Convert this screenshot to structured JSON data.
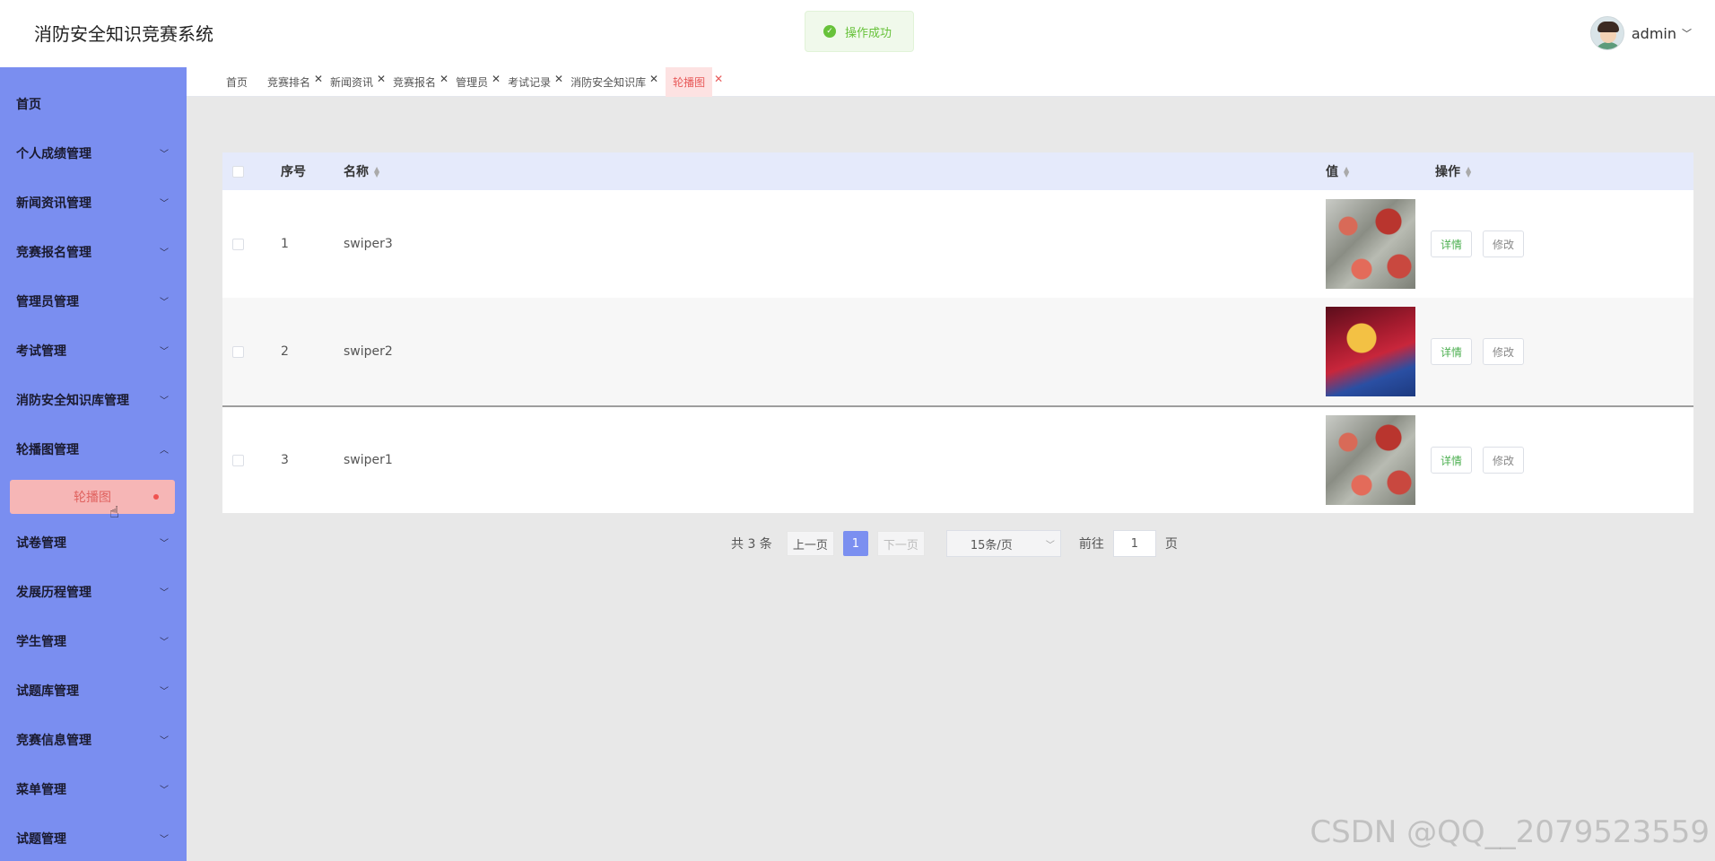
{
  "header": {
    "title": "消防安全知识竞赛系统",
    "toast": "操作成功",
    "user": "admin"
  },
  "sidebar": {
    "items": [
      {
        "label": "首页"
      },
      {
        "label": "个人成绩管理"
      },
      {
        "label": "新闻资讯管理"
      },
      {
        "label": "竞赛报名管理"
      },
      {
        "label": "管理员管理"
      },
      {
        "label": "考试管理"
      },
      {
        "label": "消防安全知识库管理"
      },
      {
        "label": "轮播图管理"
      },
      {
        "label": "试卷管理"
      },
      {
        "label": "发展历程管理"
      },
      {
        "label": "学生管理"
      },
      {
        "label": "试题库管理"
      },
      {
        "label": "竞赛信息管理"
      },
      {
        "label": "菜单管理"
      },
      {
        "label": "试题管理"
      }
    ],
    "active_sub": "轮播图"
  },
  "tabs": [
    "首页",
    "竞赛排名",
    "新闻资讯",
    "竞赛报名",
    "管理员",
    "考试记录",
    "消防安全知识库",
    "轮播图"
  ],
  "table": {
    "headers": {
      "index": "序号",
      "name": "名称",
      "value": "值",
      "ops": "操作"
    },
    "rows": [
      {
        "index": "1",
        "name": "swiper3",
        "image": "firefighters"
      },
      {
        "index": "2",
        "name": "swiper2",
        "image": "flag"
      },
      {
        "index": "3",
        "name": "swiper1",
        "image": "firefighters"
      }
    ],
    "detail_label": "详情",
    "edit_label": "修改"
  },
  "pagination": {
    "total": "共 3 条",
    "prev": "上一页",
    "current": "1",
    "next": "下一页",
    "page_size": "15条/页",
    "goto_label": "前往",
    "goto_value": "1",
    "page_suffix": "页"
  },
  "watermark": "CSDN @QQ__2079523559"
}
